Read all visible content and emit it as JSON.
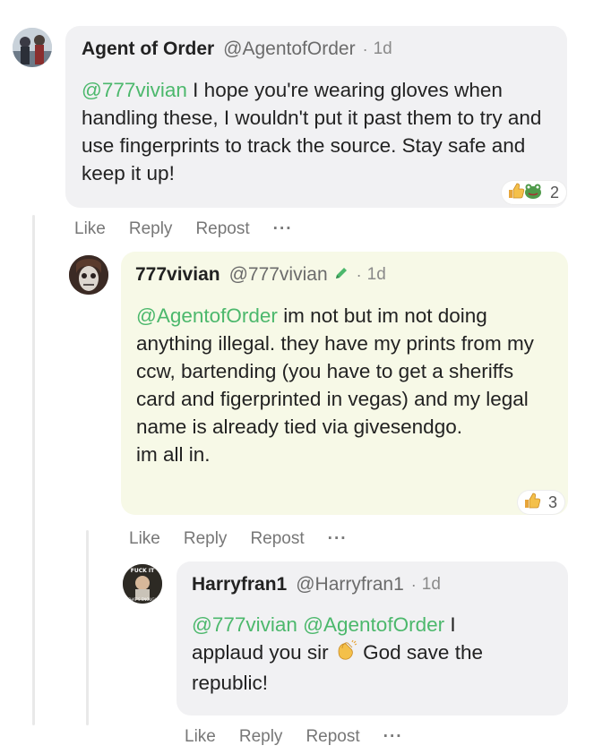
{
  "comments": [
    {
      "author": "Agent of Order",
      "handle": "@AgentofOrder",
      "separator": "·",
      "age": "1d",
      "mention": "@777vivian",
      "text": "I hope you're wearing gloves when handling these, I wouldn't put it past them to try and use fingerprints to track the source. Stay safe and keep it up!",
      "reaction_count": "2",
      "reactions": [
        "thumbs-up",
        "frog"
      ]
    },
    {
      "author": "777vivian",
      "handle": "@777vivian",
      "separator": "·",
      "age": "1d",
      "badge": "pencil-icon",
      "mention": "@AgentofOrder",
      "text_lines": [
        "im not but im not doing anything illegal. they have my prints from my ccw, bartending (you have to get a sheriffs card and figerprinted in vegas) and my legal name is already tied via givesendgo.",
        "im all in."
      ],
      "reaction_count": "3",
      "reactions": [
        "thumbs-up"
      ]
    },
    {
      "author": "Harryfran1",
      "handle": "@Harryfran1",
      "separator": "·",
      "age": "1d",
      "mention1": "@777vivian",
      "mention2": "@AgentofOrder",
      "text_before_emoji": "I applaud you sir",
      "text_after_emoji": "God save the republic!",
      "emoji": "clapping-hands",
      "avatar_text_top": "FUCK IT",
      "avatar_text_bottom": "THAT'S ENOUGH"
    }
  ],
  "actions": {
    "like": "Like",
    "reply": "Reply",
    "repost": "Repost",
    "more": "···"
  },
  "colors": {
    "mention": "#4cb86c",
    "bubble_gray": "#f1f1f3",
    "bubble_green": "#f7f9e7"
  }
}
